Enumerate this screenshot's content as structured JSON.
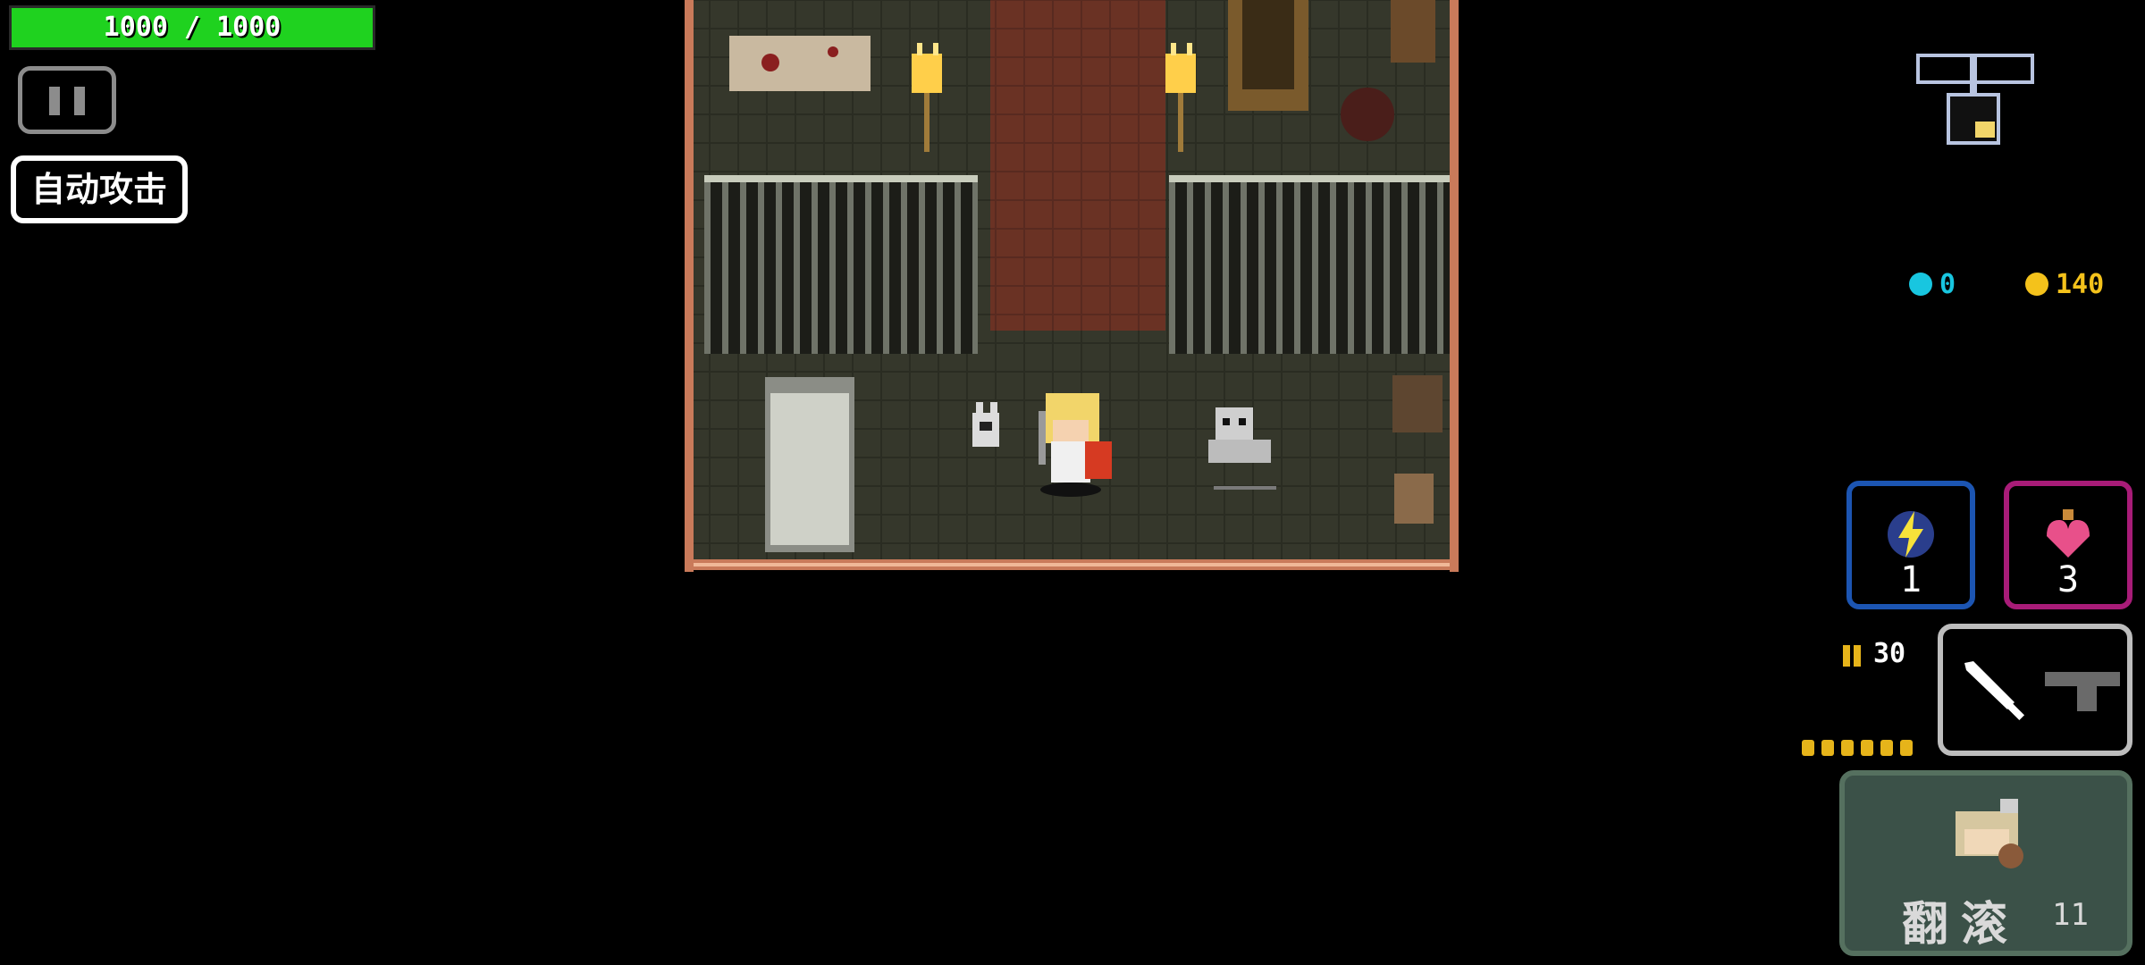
{
  "hud": {
    "hp_text": "1000 / 1000",
    "hp_fraction": 1.0,
    "auto_attack_label": "自动攻击"
  },
  "resources": {
    "energy": "0",
    "gold": "140"
  },
  "skills": {
    "skill_count": "1",
    "potion_count": "3"
  },
  "weapon": {
    "ammo": "30",
    "primary_icon": "sword-icon",
    "secondary_icon": "pistol-icon"
  },
  "roll": {
    "label": "翻滚",
    "count": "11"
  },
  "colors": {
    "hp": "#1fd21f",
    "energy": "#18c6e0",
    "gold": "#f4c21b",
    "skill_border": "#1c55b2",
    "potion_border": "#a81c78"
  }
}
